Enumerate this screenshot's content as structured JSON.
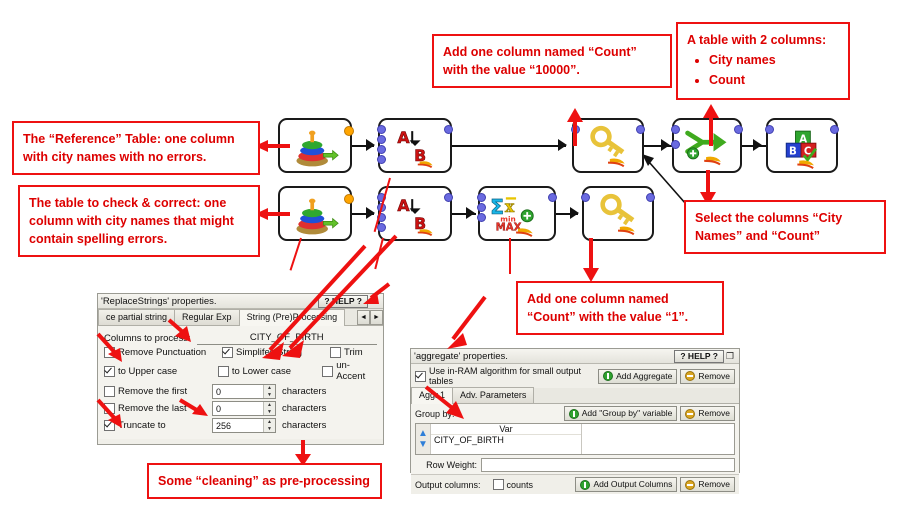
{
  "callouts": {
    "reference_table": "The “Reference”  Table: one column with city names with no errors.",
    "check_table": "The table to check & correct: one column with city names that might contain spelling errors.",
    "add_count_10000": "Add one column named “Count” with the value “10000”.",
    "table_two_columns_title": "A table with 2 columns:",
    "table_two_columns_items": [
      "City names",
      "Count"
    ],
    "select_columns": "Select the columns “City Names” and “Count”",
    "add_count_1": "Add one column named “Count” with the value “1”.",
    "cleaning": "Some “cleaning” as pre-processing"
  },
  "replace_dialog": {
    "title": "'ReplaceStrings' properties.",
    "help_label": "? HELP ?",
    "pin_glyph": "❐",
    "tabs": [
      {
        "label": "ce partial string",
        "active": false
      },
      {
        "label": "Regular Exp",
        "active": false
      },
      {
        "label": "String (Pre)Processing",
        "active": true
      }
    ],
    "tab_prev": "◄",
    "tab_next": "►",
    "columns_to_process_label": "Columns to process:",
    "columns_to_process_value": "CITY_OF_BIRTH",
    "checkboxes": [
      {
        "label": "Remove Punctuation",
        "checked": false
      },
      {
        "label": "Simplifes String",
        "checked": true
      },
      {
        "label": "Trim",
        "checked": false
      },
      {
        "label": "to Upper case",
        "checked": true
      },
      {
        "label": "to Lower case",
        "checked": false
      },
      {
        "label": "un-Accent",
        "checked": false
      }
    ],
    "spinners": [
      {
        "label": "Remove the first",
        "checked": false,
        "value": "0",
        "unit": "characters"
      },
      {
        "label": "Remove the last",
        "checked": false,
        "value": "0",
        "unit": "characters"
      },
      {
        "label": "Truncate to",
        "checked": true,
        "value": "256",
        "unit": "characters"
      }
    ]
  },
  "aggregate_dialog": {
    "title": "'aggregate' properties.",
    "help_label": "? HELP ?",
    "pin_glyph": "❐",
    "inram_label": "Use in-RAM algorithm for small output tables",
    "inram_checked": true,
    "add_aggregate_label": "Add Aggregate",
    "remove_label": "Remove",
    "tabs": [
      {
        "label": "Aggr.1",
        "active": true
      },
      {
        "label": "Adv. Parameters",
        "active": false
      }
    ],
    "group_by_label": "Group by:",
    "add_groupby_label": "Add \"Group by\" variable",
    "remove_groupby_label": "Remove",
    "grid_header": "Var",
    "grid_rows": [
      "CITY_OF_BIRTH"
    ],
    "up_glyph": "▲",
    "down_glyph": "▼",
    "row_weight_label": "Row Weight:",
    "row_weight_value": "",
    "output_columns_label": "Output columns:",
    "counts_label": "counts",
    "counts_checked": false,
    "add_output_columns_label": "Add Output Columns",
    "remove_output_label": "Remove"
  },
  "workflow": {
    "nodes": [
      {
        "id": "ref-table-source",
        "icon": "stacked-disks-table-icon"
      },
      {
        "id": "ref-replace-strings",
        "icon": "a-to-b-replace-icon"
      },
      {
        "id": "ref-add-column-key",
        "icon": "golden-key-icon"
      },
      {
        "id": "join-merge",
        "icon": "green-arrows-merge-icon"
      },
      {
        "id": "output-abc",
        "icon": "abc-blocks-check-icon"
      },
      {
        "id": "check-table-source",
        "icon": "stacked-disks-table-icon"
      },
      {
        "id": "check-replace-strings",
        "icon": "a-to-b-replace-icon"
      },
      {
        "id": "aggregate",
        "icon": "sigma-min-max-icon"
      },
      {
        "id": "check-add-column-key",
        "icon": "golden-key-icon"
      }
    ]
  },
  "colors": {
    "annotation_red": "#ee1111",
    "annotation_text": "#dd0000",
    "node_border": "#1a1a1a",
    "port_blue": "#6a6ae0",
    "port_orange": "#ffa500"
  }
}
